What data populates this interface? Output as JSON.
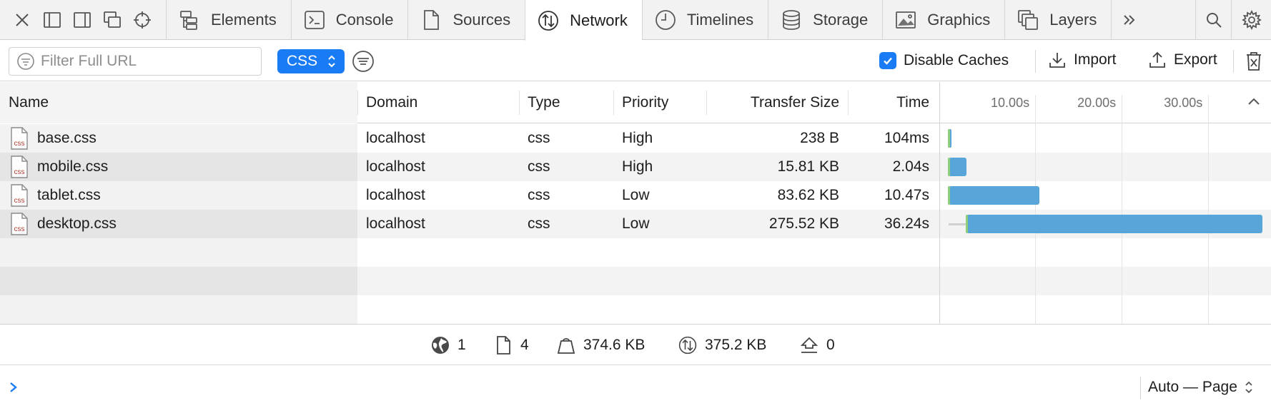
{
  "tabs": [
    {
      "label": "Elements",
      "icon": "elements-icon"
    },
    {
      "label": "Console",
      "icon": "console-icon"
    },
    {
      "label": "Sources",
      "icon": "sources-icon"
    },
    {
      "label": "Network",
      "icon": "network-icon",
      "active": true
    },
    {
      "label": "Timelines",
      "icon": "timelines-icon"
    },
    {
      "label": "Storage",
      "icon": "storage-icon"
    },
    {
      "label": "Graphics",
      "icon": "graphics-icon"
    },
    {
      "label": "Layers",
      "icon": "layers-icon"
    }
  ],
  "filter": {
    "placeholder": "Filter Full URL",
    "type_select": "CSS"
  },
  "toolbar": {
    "disable_caches_label": "Disable Caches",
    "disable_caches_checked": true,
    "import_label": "Import",
    "export_label": "Export"
  },
  "table": {
    "columns": {
      "name": "Name",
      "domain": "Domain",
      "type": "Type",
      "priority": "Priority",
      "transfer_size": "Transfer Size",
      "time": "Time"
    },
    "rows": [
      {
        "name": "base.css",
        "domain": "localhost",
        "type": "css",
        "priority": "High",
        "transfer_size": "238 B",
        "time": "104ms"
      },
      {
        "name": "mobile.css",
        "domain": "localhost",
        "type": "css",
        "priority": "High",
        "transfer_size": "15.81 KB",
        "time": "2.04s"
      },
      {
        "name": "tablet.css",
        "domain": "localhost",
        "type": "css",
        "priority": "Low",
        "transfer_size": "83.62 KB",
        "time": "10.47s"
      },
      {
        "name": "desktop.css",
        "domain": "localhost",
        "type": "css",
        "priority": "Low",
        "transfer_size": "275.52 KB",
        "time": "36.24s"
      }
    ]
  },
  "timeline": {
    "ticks": [
      "10.00s",
      "20.00s",
      "30.00s"
    ],
    "scale_max_seconds": 37,
    "bars": [
      {
        "start": 0.0,
        "duration": 0.104
      },
      {
        "start": 0.0,
        "duration": 2.04
      },
      {
        "start": 0.0,
        "duration": 10.47
      },
      {
        "start": 2.1,
        "duration": 34.14
      }
    ]
  },
  "stats": {
    "domains": "1",
    "resources": "4",
    "size": "374.6 KB",
    "transferred": "375.2 KB",
    "websockets": "0"
  },
  "console": {
    "scope_label": "Auto — Page"
  },
  "colors": {
    "accent": "#1a7cf5",
    "bar": "#58a6d9",
    "css_icon": "#b23a2e"
  }
}
